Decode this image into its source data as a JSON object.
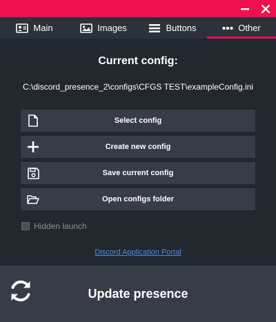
{
  "window": {
    "accent_color": "#f0104f",
    "controls": [
      "minimize-icon",
      "close-icon"
    ]
  },
  "tabs": [
    {
      "label": "Main",
      "icon": "user-card-icon",
      "active": false
    },
    {
      "label": "Images",
      "icon": "image-icon",
      "active": false
    },
    {
      "label": "Buttons",
      "icon": "bars-icon",
      "active": false
    },
    {
      "label": "Other",
      "icon": "more-dots-icon",
      "active": true
    }
  ],
  "config": {
    "heading": "Current config:",
    "path": "C:\\discord_presence_2\\configs\\CFGS TEST\\exampleConfig.ini"
  },
  "actions": [
    {
      "label": "Select config",
      "icon": "file-icon"
    },
    {
      "label": "Create new config",
      "icon": "plus-icon"
    },
    {
      "label": "Save current config",
      "icon": "floppy-disk-icon"
    },
    {
      "label": "Open configs folder",
      "icon": "folder-open-icon"
    }
  ],
  "hidden_launch": {
    "label": "Hidden launch",
    "checked": false
  },
  "portal_link": {
    "label": "Discord Application Portal"
  },
  "update": {
    "label": "Update presence",
    "icon": "refresh-icon"
  }
}
